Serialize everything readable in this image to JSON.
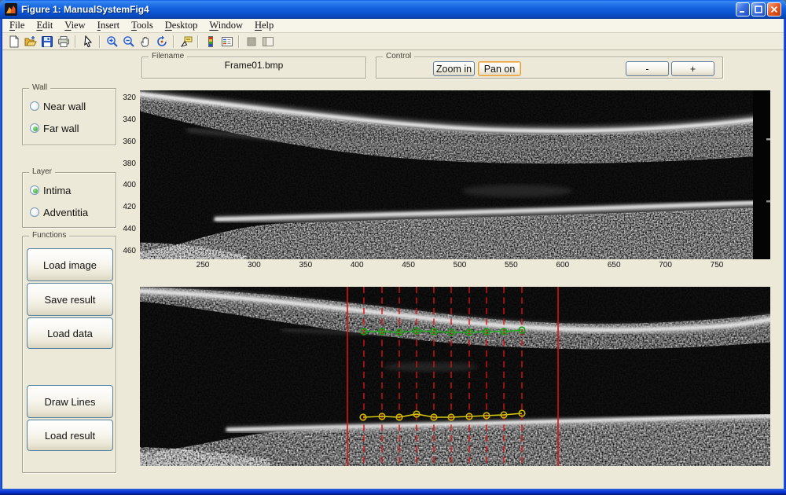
{
  "window": {
    "title": "Figure 1: ManualSystemFig4"
  },
  "menu": {
    "items": [
      "File",
      "Edit",
      "View",
      "Insert",
      "Tools",
      "Desktop",
      "Window",
      "Help"
    ]
  },
  "toolbar": {
    "icons": [
      "new-document",
      "open-folder",
      "save-figure",
      "print-figure",
      "|",
      "pointer",
      "|",
      "zoom-in",
      "zoom-out",
      "pan-hand",
      "rotate-3d",
      "|",
      "data-cursor",
      "|",
      "insert-colorbar",
      "insert-legend",
      "|",
      "hide-plot-tools",
      "show-plot-tools"
    ]
  },
  "filename_panel": {
    "label": "Filename",
    "value": "Frame01.bmp"
  },
  "control_panel": {
    "label": "Control",
    "buttons": {
      "zoom_in": "Zoom in",
      "pan_on": "Pan on",
      "minus": "-",
      "plus": "+"
    }
  },
  "wall_panel": {
    "label": "Wall",
    "options": [
      {
        "label": "Near wall",
        "selected": false
      },
      {
        "label": "Far wall",
        "selected": true
      }
    ]
  },
  "layer_panel": {
    "label": "Layer",
    "options": [
      {
        "label": "Intima",
        "selected": true
      },
      {
        "label": "Adventitia",
        "selected": false
      }
    ]
  },
  "functions_panel": {
    "label": "Functions",
    "buttons": [
      "Load image",
      "Save result",
      "Load data",
      "Draw Lines",
      "Load result"
    ]
  },
  "top_axes": {
    "y_ticks": [
      "320",
      "340",
      "360",
      "380",
      "400",
      "420",
      "440",
      "460"
    ],
    "x_ticks": [
      "250",
      "300",
      "350",
      "400",
      "450",
      "500",
      "550",
      "600",
      "650",
      "700",
      "750"
    ]
  },
  "bottom_axes": {
    "overlay": {
      "line_color": "#dd1111",
      "solid_lines_x": [
        264,
        532
      ],
      "dashed_lines_x": [
        285,
        308,
        330,
        352,
        374,
        396,
        419,
        441,
        463,
        486
      ],
      "upper_line": {
        "color": "#1db31d",
        "marker_color": "#129e12",
        "points": [
          [
            285,
            57
          ],
          [
            308,
            57
          ],
          [
            330,
            58
          ],
          [
            352,
            56
          ],
          [
            374,
            57
          ],
          [
            396,
            58
          ],
          [
            419,
            58
          ],
          [
            441,
            57
          ],
          [
            463,
            57
          ],
          [
            486,
            55
          ]
        ]
      },
      "lower_line": {
        "color": "#d8ca10",
        "marker_color": "#c9ba00",
        "points": [
          [
            284,
            166
          ],
          [
            308,
            165
          ],
          [
            330,
            166
          ],
          [
            352,
            162
          ],
          [
            374,
            166
          ],
          [
            396,
            166
          ],
          [
            419,
            165
          ],
          [
            441,
            164
          ],
          [
            463,
            163
          ],
          [
            486,
            161
          ]
        ]
      }
    }
  },
  "colors": {
    "background": "#ece9d8",
    "titlebar": "#1360dd",
    "roi_red": "#dd1111",
    "upper_green": "#1db31d",
    "lower_yellow": "#d8ca10"
  }
}
